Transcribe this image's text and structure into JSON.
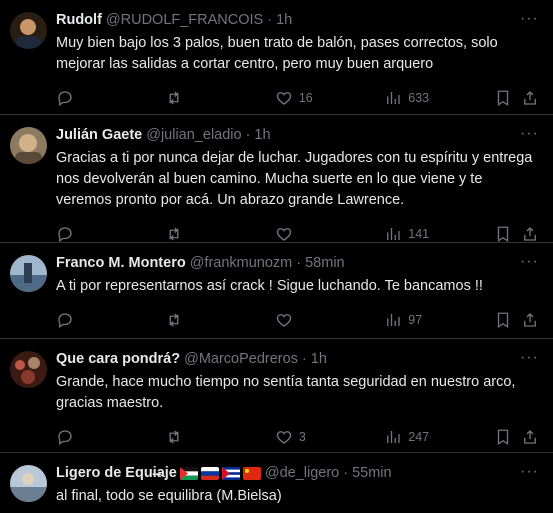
{
  "tweets": [
    {
      "name": "Rudolf",
      "handle": "@RUDOLF_FRANCOIS",
      "time": "1h",
      "text": "Muy bien bajo los 3 palos, buen trato de balón, pases correctos, solo mejorar las salidas a cortar centro, pero muy buen arquero",
      "likes": "16",
      "views": "633",
      "avatar_color": "#3a2a1a"
    },
    {
      "name": "Julián Gaete",
      "handle": "@julian_eladio",
      "time": "1h",
      "text": "Gracias a ti por nunca dejar de luchar. Jugadores con tu espíritu y entrega nos devolverán al buen camino. Mucha suerte en lo que viene y te veremos pronto por acá. Un abrazo grande Lawrence.",
      "likes": "",
      "views": "141",
      "avatar_color": "#7a6a52"
    },
    {
      "name": "Franco M. Montero",
      "handle": "@frankmunozm",
      "time": "58min",
      "text": "A ti por representarnos así crack ! Sigue luchando. Te bancamos !!",
      "likes": "",
      "views": "97",
      "avatar_color": "#6f8aa8"
    },
    {
      "name": "Que cara pondrá?",
      "handle": "@MarcoPedreros",
      "time": "1h",
      "text": "Grande, hace mucho tiempo no sentía tanta seguridad en nuestro arco, gracias maestro.",
      "likes": "3",
      "views": "247",
      "avatar_color": "#5a2a1e"
    },
    {
      "name": "Ligero de Equi̶aje",
      "handle": "@de_ligero",
      "time": "55min",
      "text": "al final, todo se equilibra (M.Bielsa)",
      "likes": "",
      "views": "",
      "avatar_color": "#8aa0b8"
    }
  ],
  "ui": {
    "more_glyph": "···",
    "separator": "·"
  },
  "icons": [
    "reply-icon",
    "retweet-icon",
    "like-icon",
    "views-icon",
    "bookmark-icon",
    "share-icon",
    "more-icon"
  ]
}
